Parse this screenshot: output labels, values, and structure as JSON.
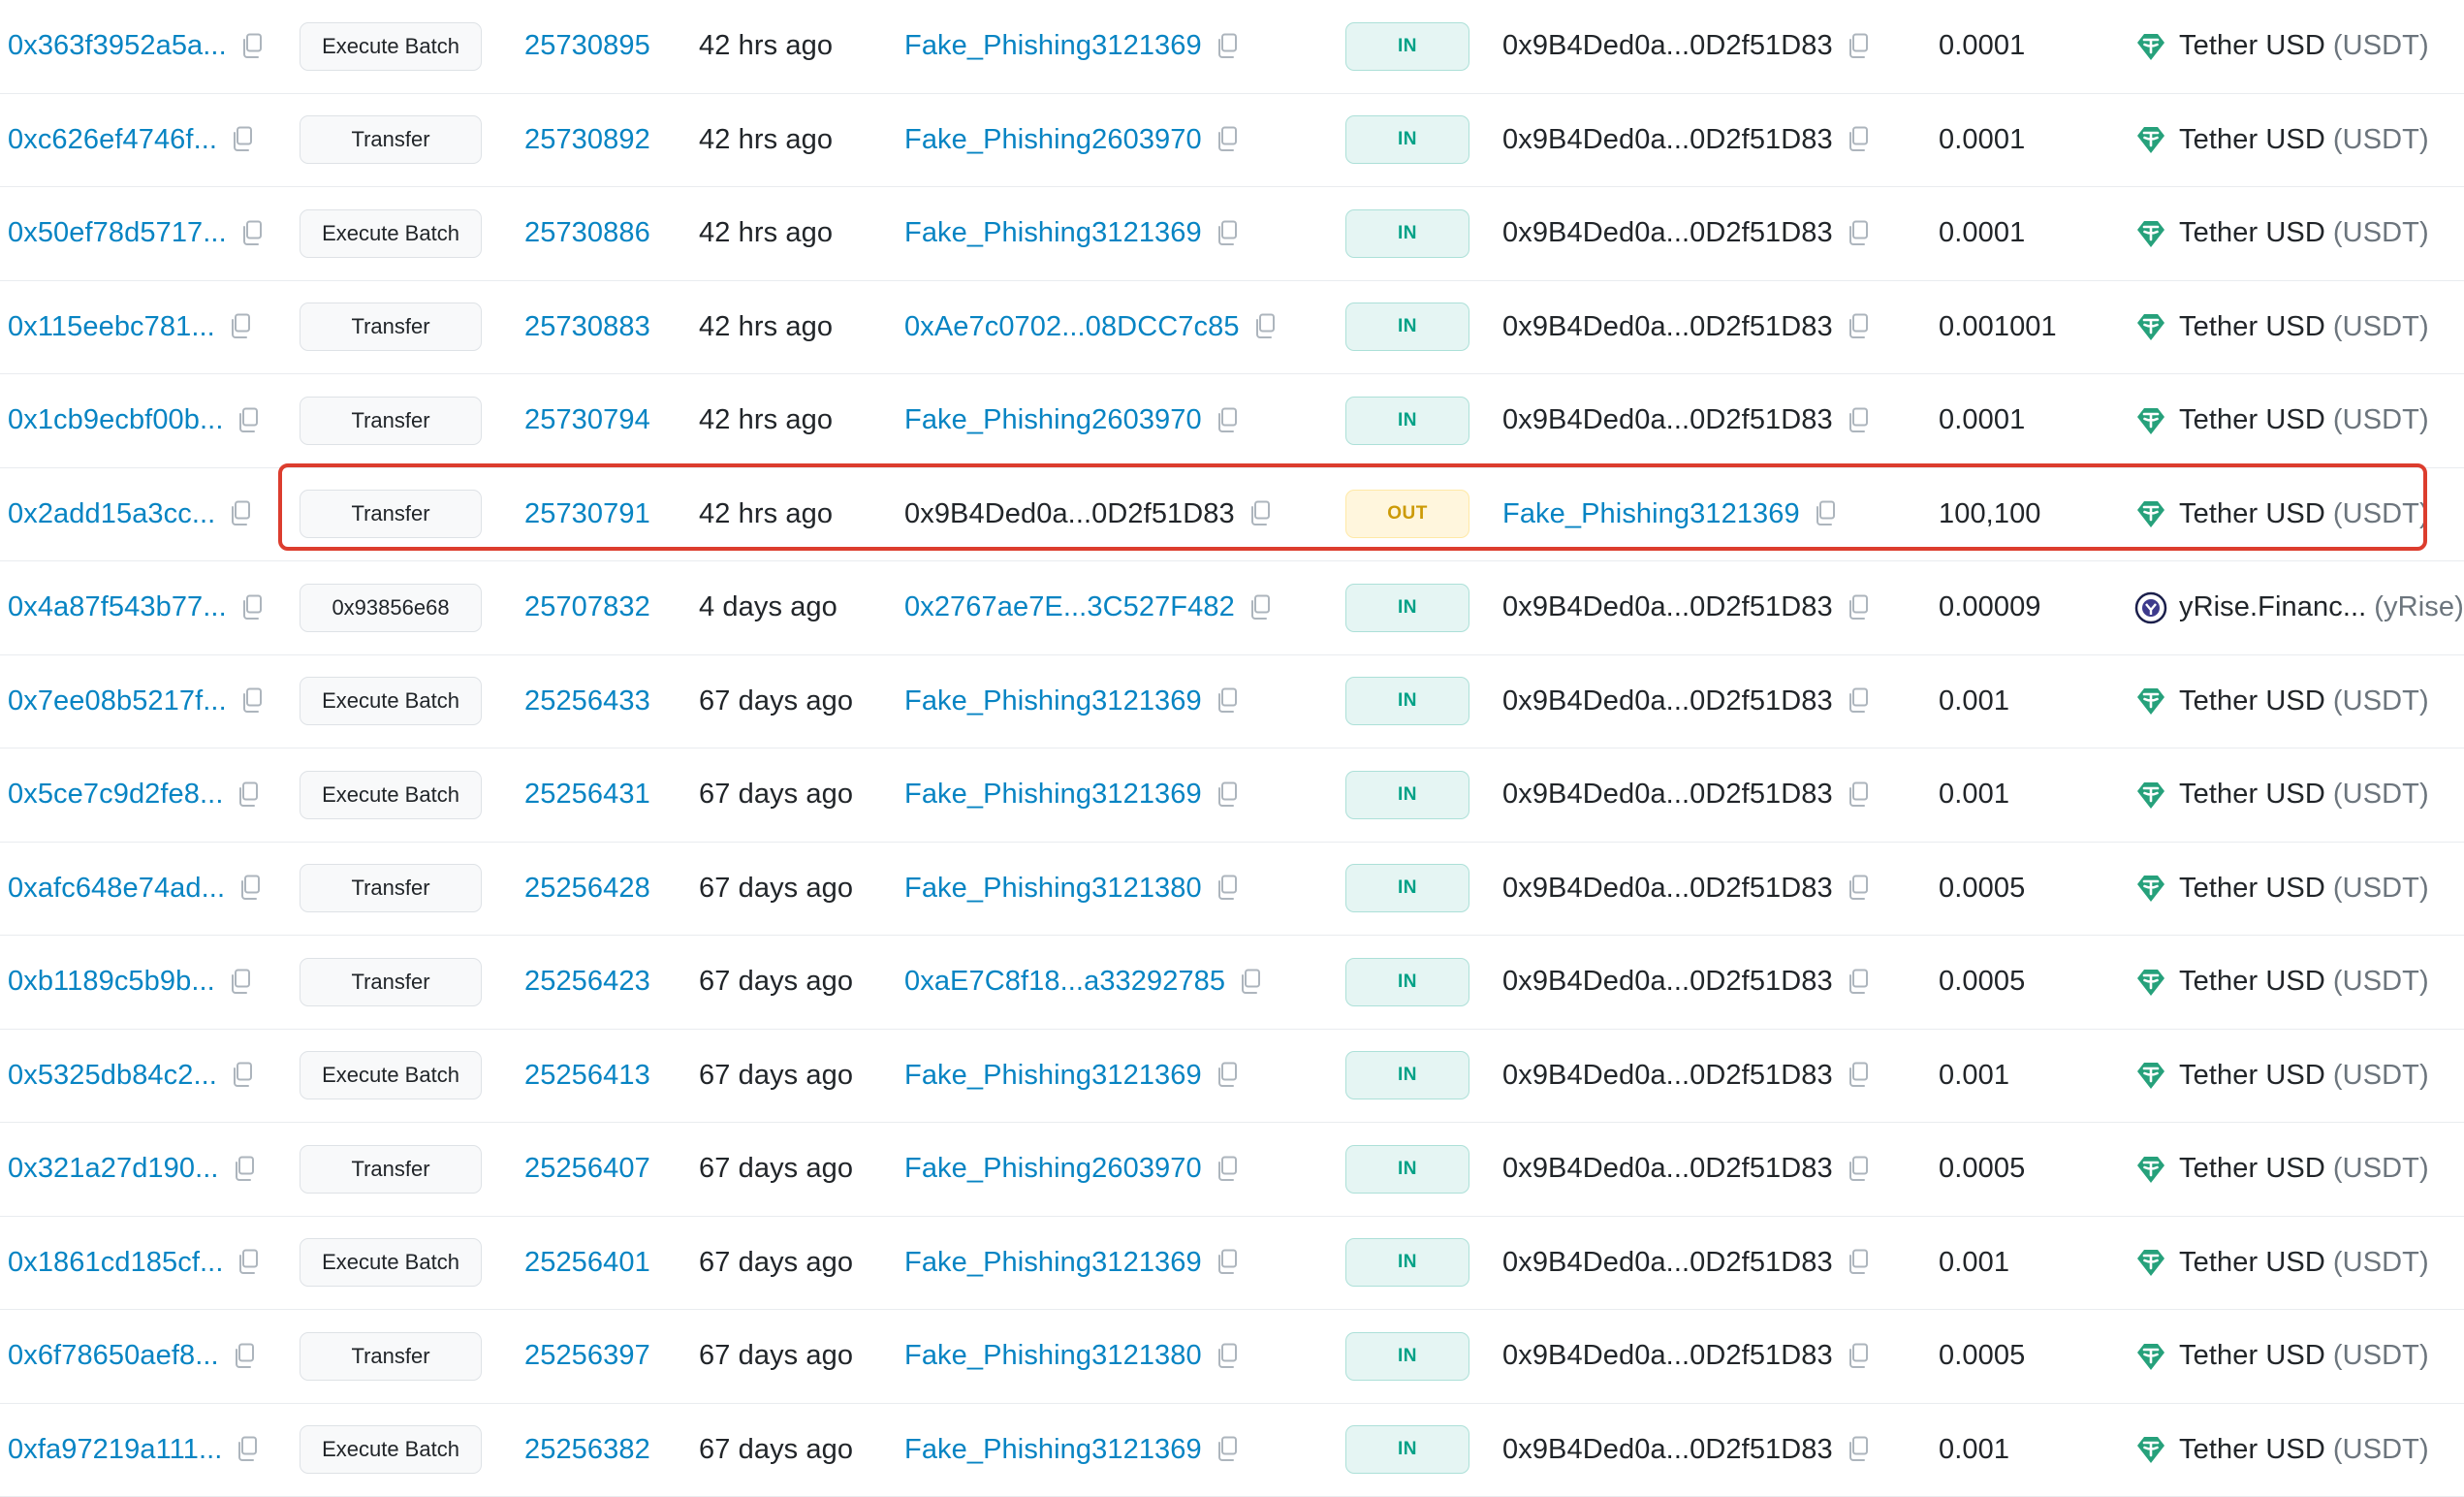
{
  "icons": {
    "copy": "copy-icon",
    "tether": "tether-icon",
    "yrise": "yrise-icon"
  },
  "colors": {
    "link": "#0784c3",
    "in_badge": "#00a186",
    "out_badge": "#cc9a06",
    "highlight_border": "#dc3d2e",
    "tether": "#26a17b"
  },
  "transactions": [
    {
      "hash": "0x363f3952a5a...",
      "method": "Execute Batch",
      "block": "25730895",
      "age": "42 hrs ago",
      "from": "Fake_Phishing3121369",
      "from_is_link": true,
      "direction": "IN",
      "to": "0x9B4Ded0a...0D2f51D83",
      "to_is_link": false,
      "amount": "0.0001",
      "token_name": "Tether USD",
      "token_symbol": "(USDT)",
      "token_icon": "tether-icon"
    },
    {
      "hash": "0xc626ef4746f...",
      "method": "Transfer",
      "block": "25730892",
      "age": "42 hrs ago",
      "from": "Fake_Phishing2603970",
      "from_is_link": true,
      "direction": "IN",
      "to": "0x9B4Ded0a...0D2f51D83",
      "to_is_link": false,
      "amount": "0.0001",
      "token_name": "Tether USD",
      "token_symbol": "(USDT)",
      "token_icon": "tether-icon"
    },
    {
      "hash": "0x50ef78d5717...",
      "method": "Execute Batch",
      "block": "25730886",
      "age": "42 hrs ago",
      "from": "Fake_Phishing3121369",
      "from_is_link": true,
      "direction": "IN",
      "to": "0x9B4Ded0a...0D2f51D83",
      "to_is_link": false,
      "amount": "0.0001",
      "token_name": "Tether USD",
      "token_symbol": "(USDT)",
      "token_icon": "tether-icon"
    },
    {
      "hash": "0x115eebc781...",
      "method": "Transfer",
      "block": "25730883",
      "age": "42 hrs ago",
      "from": "0xAe7c0702...08DCC7c85",
      "from_is_link": true,
      "direction": "IN",
      "to": "0x9B4Ded0a...0D2f51D83",
      "to_is_link": false,
      "amount": "0.001001",
      "token_name": "Tether USD",
      "token_symbol": "(USDT)",
      "token_icon": "tether-icon"
    },
    {
      "hash": "0x1cb9ecbf00b...",
      "method": "Transfer",
      "block": "25730794",
      "age": "42 hrs ago",
      "from": "Fake_Phishing2603970",
      "from_is_link": true,
      "direction": "IN",
      "to": "0x9B4Ded0a...0D2f51D83",
      "to_is_link": false,
      "amount": "0.0001",
      "token_name": "Tether USD",
      "token_symbol": "(USDT)",
      "token_icon": "tether-icon"
    },
    {
      "hash": "0x2add15a3cc...",
      "method": "Transfer",
      "block": "25730791",
      "age": "42 hrs ago",
      "from": "0x9B4Ded0a...0D2f51D83",
      "from_is_link": false,
      "direction": "OUT",
      "to": "Fake_Phishing3121369",
      "to_is_link": true,
      "amount": "100,100",
      "token_name": "Tether USD",
      "token_symbol": "(USDT)",
      "token_icon": "tether-icon"
    },
    {
      "hash": "0x4a87f543b77...",
      "method": "0x93856e68",
      "block": "25707832",
      "age": "4 days ago",
      "from": "0x2767ae7E...3C527F482",
      "from_is_link": true,
      "direction": "IN",
      "to": "0x9B4Ded0a...0D2f51D83",
      "to_is_link": false,
      "amount": "0.00009",
      "token_name": "yRise.Financ...",
      "token_symbol": "(yRise)",
      "token_icon": "yrise-icon"
    },
    {
      "hash": "0x7ee08b5217f...",
      "method": "Execute Batch",
      "block": "25256433",
      "age": "67 days ago",
      "from": "Fake_Phishing3121369",
      "from_is_link": true,
      "direction": "IN",
      "to": "0x9B4Ded0a...0D2f51D83",
      "to_is_link": false,
      "amount": "0.001",
      "token_name": "Tether USD",
      "token_symbol": "(USDT)",
      "token_icon": "tether-icon"
    },
    {
      "hash": "0x5ce7c9d2fe8...",
      "method": "Execute Batch",
      "block": "25256431",
      "age": "67 days ago",
      "from": "Fake_Phishing3121369",
      "from_is_link": true,
      "direction": "IN",
      "to": "0x9B4Ded0a...0D2f51D83",
      "to_is_link": false,
      "amount": "0.001",
      "token_name": "Tether USD",
      "token_symbol": "(USDT)",
      "token_icon": "tether-icon"
    },
    {
      "hash": "0xafc648e74ad...",
      "method": "Transfer",
      "block": "25256428",
      "age": "67 days ago",
      "from": "Fake_Phishing3121380",
      "from_is_link": true,
      "direction": "IN",
      "to": "0x9B4Ded0a...0D2f51D83",
      "to_is_link": false,
      "amount": "0.0005",
      "token_name": "Tether USD",
      "token_symbol": "(USDT)",
      "token_icon": "tether-icon"
    },
    {
      "hash": "0xb1189c5b9b...",
      "method": "Transfer",
      "block": "25256423",
      "age": "67 days ago",
      "from": "0xaE7C8f18...a33292785",
      "from_is_link": true,
      "direction": "IN",
      "to": "0x9B4Ded0a...0D2f51D83",
      "to_is_link": false,
      "amount": "0.0005",
      "token_name": "Tether USD",
      "token_symbol": "(USDT)",
      "token_icon": "tether-icon"
    },
    {
      "hash": "0x5325db84c2...",
      "method": "Execute Batch",
      "block": "25256413",
      "age": "67 days ago",
      "from": "Fake_Phishing3121369",
      "from_is_link": true,
      "direction": "IN",
      "to": "0x9B4Ded0a...0D2f51D83",
      "to_is_link": false,
      "amount": "0.001",
      "token_name": "Tether USD",
      "token_symbol": "(USDT)",
      "token_icon": "tether-icon"
    },
    {
      "hash": "0x321a27d190...",
      "method": "Transfer",
      "block": "25256407",
      "age": "67 days ago",
      "from": "Fake_Phishing2603970",
      "from_is_link": true,
      "direction": "IN",
      "to": "0x9B4Ded0a...0D2f51D83",
      "to_is_link": false,
      "amount": "0.0005",
      "token_name": "Tether USD",
      "token_symbol": "(USDT)",
      "token_icon": "tether-icon"
    },
    {
      "hash": "0x1861cd185cf...",
      "method": "Execute Batch",
      "block": "25256401",
      "age": "67 days ago",
      "from": "Fake_Phishing3121369",
      "from_is_link": true,
      "direction": "IN",
      "to": "0x9B4Ded0a...0D2f51D83",
      "to_is_link": false,
      "amount": "0.001",
      "token_name": "Tether USD",
      "token_symbol": "(USDT)",
      "token_icon": "tether-icon"
    },
    {
      "hash": "0x6f78650aef8...",
      "method": "Transfer",
      "block": "25256397",
      "age": "67 days ago",
      "from": "Fake_Phishing3121380",
      "from_is_link": true,
      "direction": "IN",
      "to": "0x9B4Ded0a...0D2f51D83",
      "to_is_link": false,
      "amount": "0.0005",
      "token_name": "Tether USD",
      "token_symbol": "(USDT)",
      "token_icon": "tether-icon"
    },
    {
      "hash": "0xfa97219a111...",
      "method": "Execute Batch",
      "block": "25256382",
      "age": "67 days ago",
      "from": "Fake_Phishing3121369",
      "from_is_link": true,
      "direction": "IN",
      "to": "0x9B4Ded0a...0D2f51D83",
      "to_is_link": false,
      "amount": "0.001",
      "token_name": "Tether USD",
      "token_symbol": "(USDT)",
      "token_icon": "tether-icon"
    }
  ],
  "highlighted_row": 5
}
